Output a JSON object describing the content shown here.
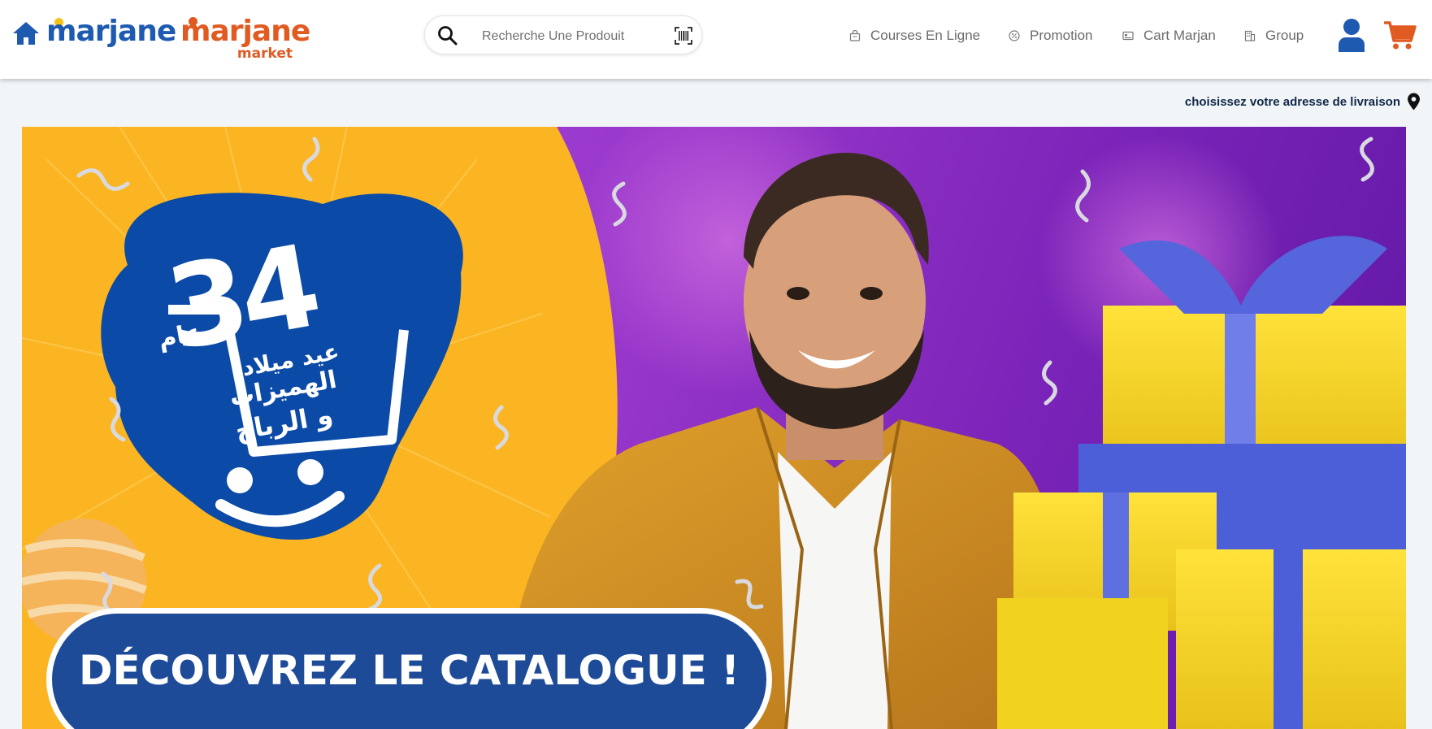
{
  "header": {
    "logo_primary": "marjane",
    "logo_secondary_main": "marjane",
    "logo_secondary_sub": "market",
    "search": {
      "placeholder": "Recherche Une Prodouit"
    },
    "nav": [
      {
        "label": "Courses En Ligne",
        "icon": "shopping-bag-icon"
      },
      {
        "label": "Promotion",
        "icon": "percent-icon"
      },
      {
        "label": "Cart Marjan",
        "icon": "card-icon"
      },
      {
        "label": "Group",
        "icon": "building-icon"
      }
    ],
    "icons": [
      "home-icon",
      "search-icon",
      "barcode-icon",
      "user-icon",
      "cart-icon"
    ]
  },
  "delivery": {
    "label": "choisissez votre adresse de livraison",
    "icon": "location-pin-icon"
  },
  "banner": {
    "age_number": "34",
    "age_word": "عام",
    "tagline_line1": "عيد ميلاد",
    "tagline_line2": "الهميزات",
    "tagline_line3": "و الرباح",
    "cta_label": "DÉCOUVREZ LE CATALOGUE !"
  },
  "colors": {
    "brand_blue": "#1d5ab0",
    "brand_orange": "#e05a22",
    "banner_yellow": "#fbb522",
    "banner_purple": "#9a38cc",
    "cta_blue": "#1e4b98"
  }
}
